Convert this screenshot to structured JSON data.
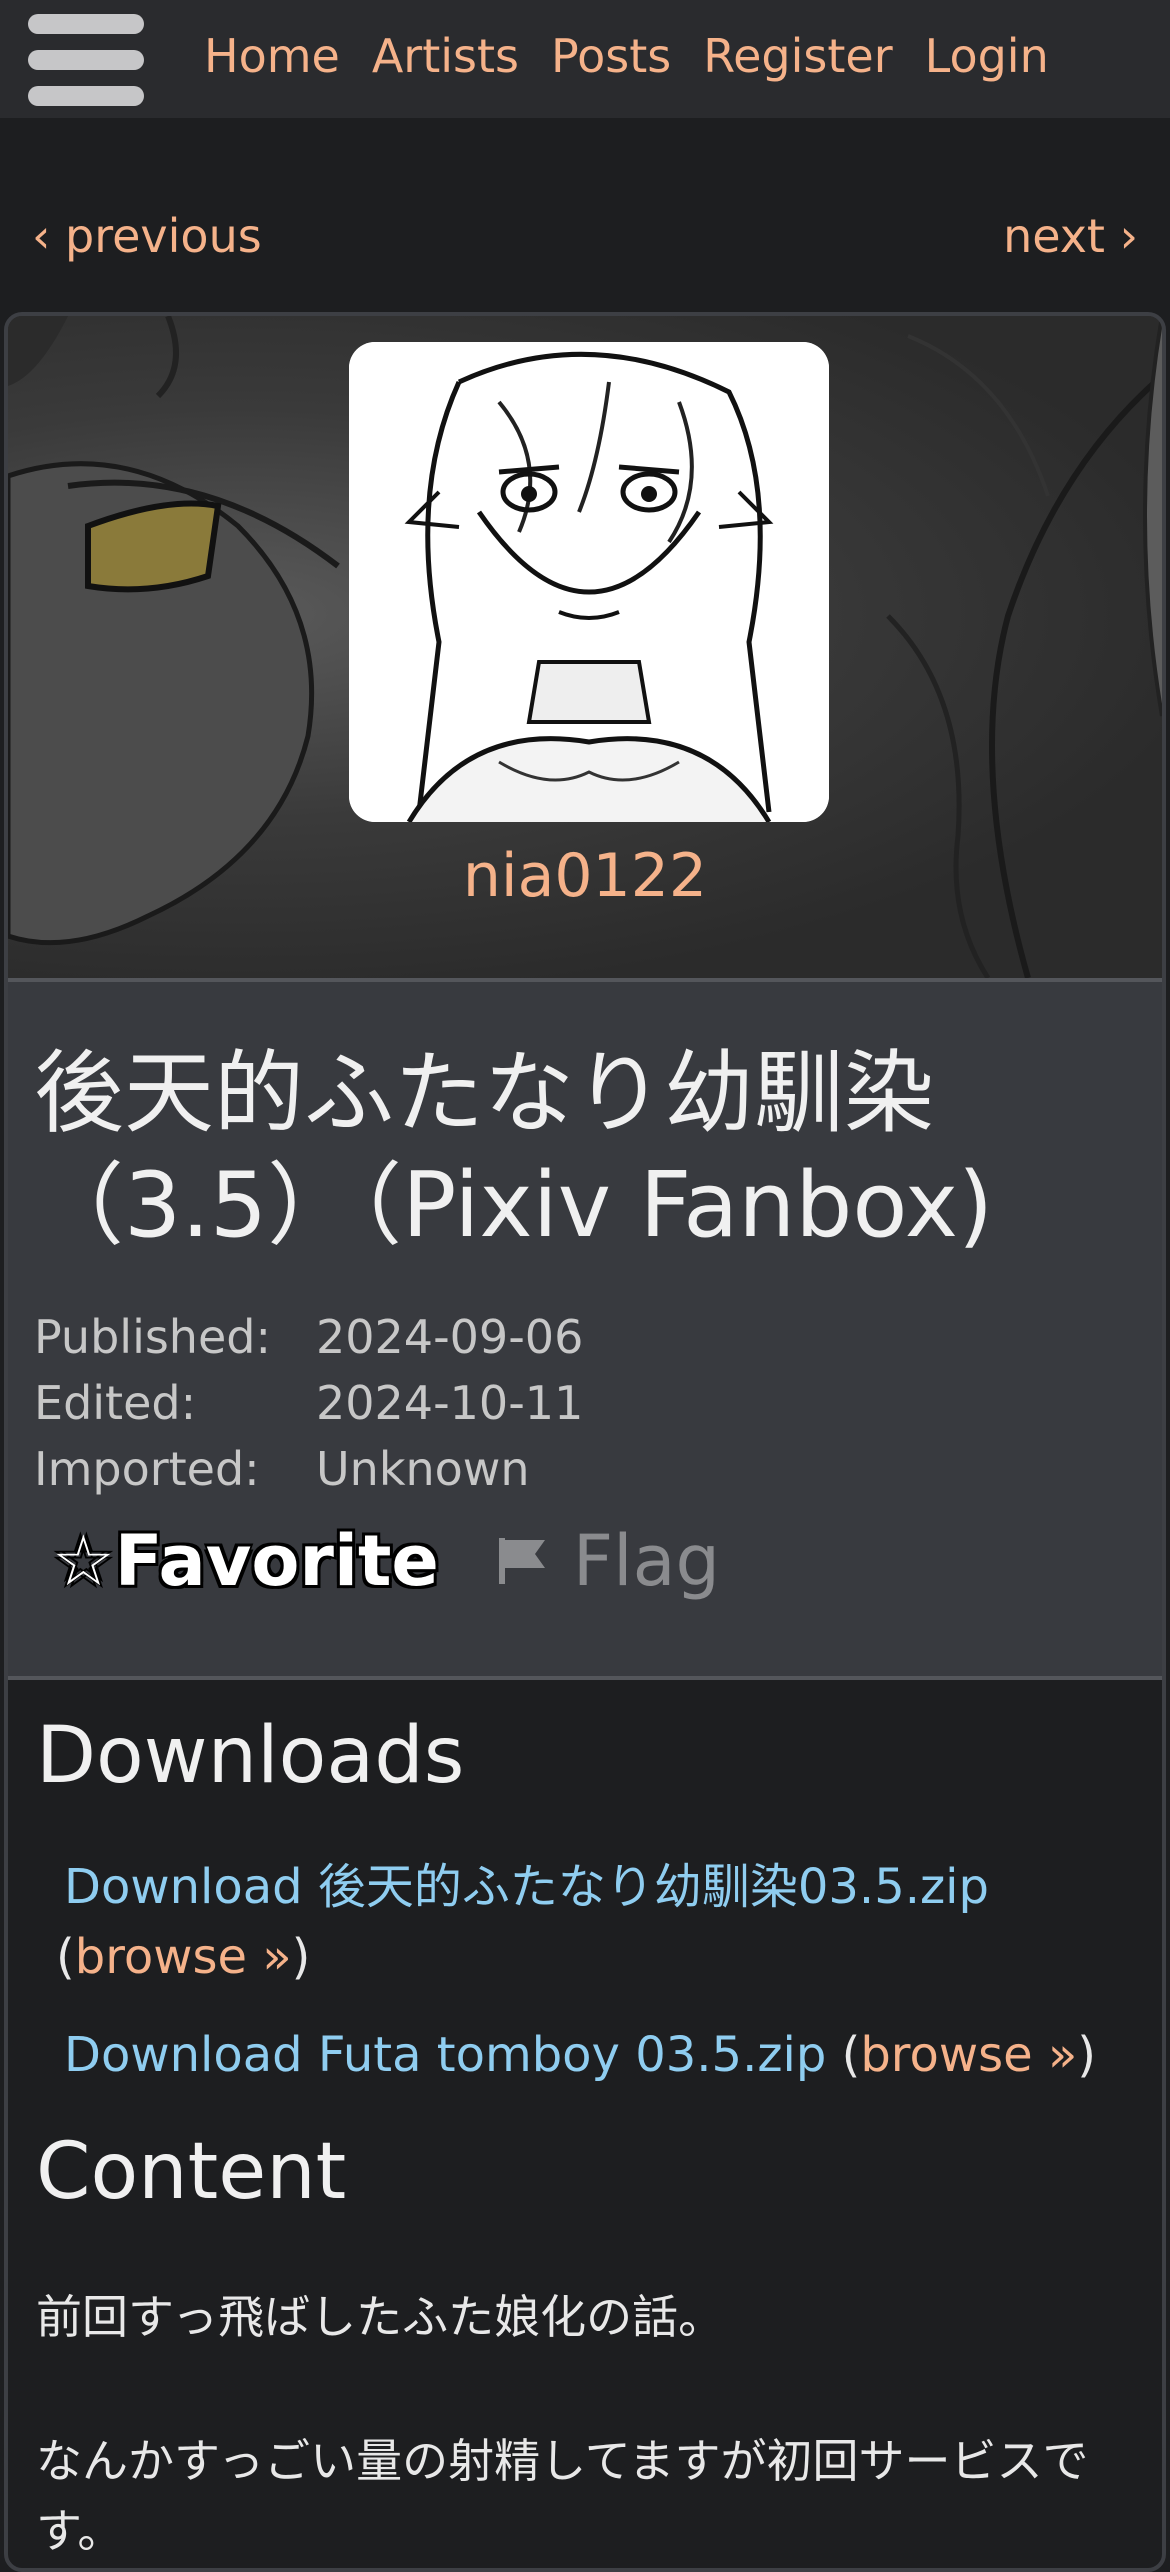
{
  "nav": {
    "menu_icon": "hamburger-menu-icon",
    "items": [
      "Home",
      "Artists",
      "Posts",
      "Register",
      "Login"
    ]
  },
  "pager": {
    "previous": "‹ previous",
    "next": "next ›"
  },
  "artist": {
    "name": "nia0122"
  },
  "post": {
    "title": "後天的ふたなり幼馴染（3.5）（Pixiv Fanbox)",
    "meta": [
      {
        "label": "Published:",
        "value": "2024-09-06"
      },
      {
        "label": "Edited:",
        "value": "2024-10-11"
      },
      {
        "label": "Imported:",
        "value": "Unknown"
      }
    ],
    "favorite_label": "☆Favorite",
    "flag_icon": "flag-icon",
    "flag_label": "Flag"
  },
  "downloads": {
    "heading": "Downloads",
    "files": [
      {
        "link": "Download 後天的ふたなり幼馴染03.5.zip",
        "browse": "browse »"
      },
      {
        "link": "Download Futa tomboy 03.5.zip",
        "browse": "browse »"
      }
    ]
  },
  "content": {
    "heading": "Content",
    "paragraphs": [
      "前回すっ飛ばしたふた娘化の話。",
      "なんかすっごい量の射精してますが初回サービスです。"
    ]
  },
  "colors": {
    "accent": "#f5b28a",
    "link": "#8fcdf0",
    "background": "#1d1e20",
    "header": "#2a2b2e",
    "info_panel": "#383a3f"
  }
}
